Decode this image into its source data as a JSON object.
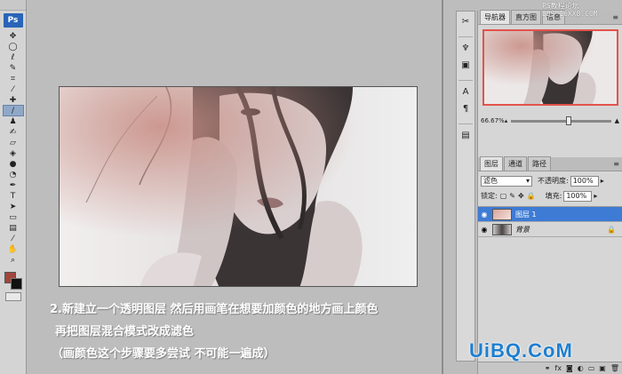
{
  "toolbar": {
    "logo": "Ps",
    "tools": [
      {
        "icon": "move-icon",
        "glyph": "✥"
      },
      {
        "icon": "marquee-icon",
        "glyph": "◯"
      },
      {
        "icon": "lasso-icon",
        "glyph": "ℓ"
      },
      {
        "icon": "quick-select-icon",
        "glyph": "✎"
      },
      {
        "icon": "crop-icon",
        "glyph": "⌗"
      },
      {
        "icon": "eyedropper-icon",
        "glyph": "⁄"
      },
      {
        "icon": "healing-icon",
        "glyph": "✚"
      },
      {
        "icon": "brush-icon",
        "glyph": "∕",
        "selected": true
      },
      {
        "icon": "stamp-icon",
        "glyph": "♟"
      },
      {
        "icon": "history-brush-icon",
        "glyph": "✍"
      },
      {
        "icon": "eraser-icon",
        "glyph": "▱"
      },
      {
        "icon": "bucket-icon",
        "glyph": "◈"
      },
      {
        "icon": "blur-icon",
        "glyph": "●"
      },
      {
        "icon": "dodge-icon",
        "glyph": "◔"
      },
      {
        "icon": "pen-icon",
        "glyph": "✒"
      },
      {
        "icon": "type-icon",
        "glyph": "T"
      },
      {
        "icon": "path-select-icon",
        "glyph": "➤"
      },
      {
        "icon": "shape-icon",
        "glyph": "▭"
      },
      {
        "icon": "notes-icon",
        "glyph": "▤"
      },
      {
        "icon": "color-sampler-icon",
        "glyph": "⁄"
      },
      {
        "icon": "hand-icon",
        "glyph": "✋"
      },
      {
        "icon": "zoom-icon",
        "glyph": "⌕"
      }
    ],
    "foreground_color": "#a0463c",
    "background_color": "#111111"
  },
  "caption": {
    "line1": "2.新建立一个透明图层 然后用画笔在想要加颜色的地方画上颜色",
    "line2": "再把图层混合模式改成滤色",
    "line3": "（画颜色这个步骤要多尝试 不可能一遍成）"
  },
  "navigator": {
    "tabs": [
      "导航器",
      "直方图",
      "信息"
    ],
    "zoom": "66.67%"
  },
  "layers_panel": {
    "tabs": [
      "图层",
      "通道",
      "路径"
    ],
    "blend_mode": "滤色",
    "opacity_label": "不透明度:",
    "opacity_value": "100%",
    "lock_label": "锁定:",
    "fill_label": "填充:",
    "fill_value": "100%",
    "layers": [
      {
        "name": "图层 1",
        "selected": true
      },
      {
        "name": "背景",
        "selected": false
      }
    ]
  },
  "watermark": {
    "top_line1": "PS教程论坛",
    "top_line2": "BBS.16XX8.COM",
    "bottom": "UiBQ.CoM"
  },
  "colors": {
    "accent_selection": "#3e7bd4",
    "navigator_frame": "#e2534c",
    "workspace": "#bdbdbd"
  }
}
